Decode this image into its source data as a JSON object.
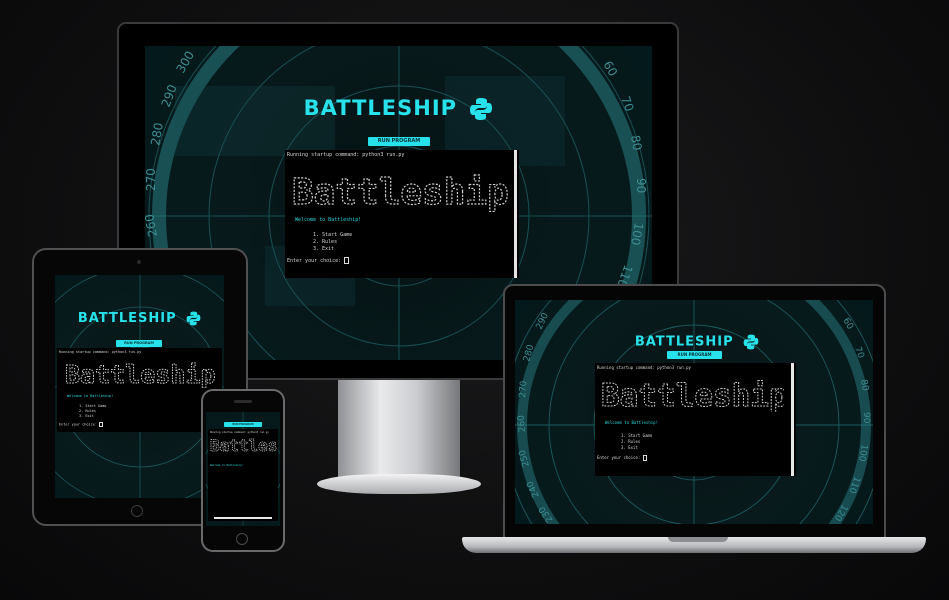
{
  "app": {
    "title": "BATTLESHIP",
    "run_button": "RUN PROGRAM",
    "startup_line": "Running startup command: python3 run.py",
    "ascii_banner": "Battleship",
    "welcome_line": "Welcome to Battleship!",
    "menu_items": [
      "1. Start Game",
      "2. Rules",
      "3. Exit"
    ],
    "prompt": "Enter your choice: "
  },
  "radar_labels": {
    "left": [
      "300",
      "290",
      "280",
      "270",
      "260"
    ],
    "right": [
      "60",
      "70",
      "80",
      "90",
      "100",
      "110"
    ],
    "laptop_left": [
      "290",
      "280",
      "270",
      "260",
      "250",
      "240",
      "230"
    ],
    "laptop_right": [
      "60",
      "70",
      "80",
      "90",
      "100",
      "110",
      "120"
    ]
  },
  "colors": {
    "accent": "#27e2ea",
    "background": "#0d0d0e",
    "terminal": "#000000"
  },
  "icons": {
    "logo": "python-logo-icon"
  }
}
